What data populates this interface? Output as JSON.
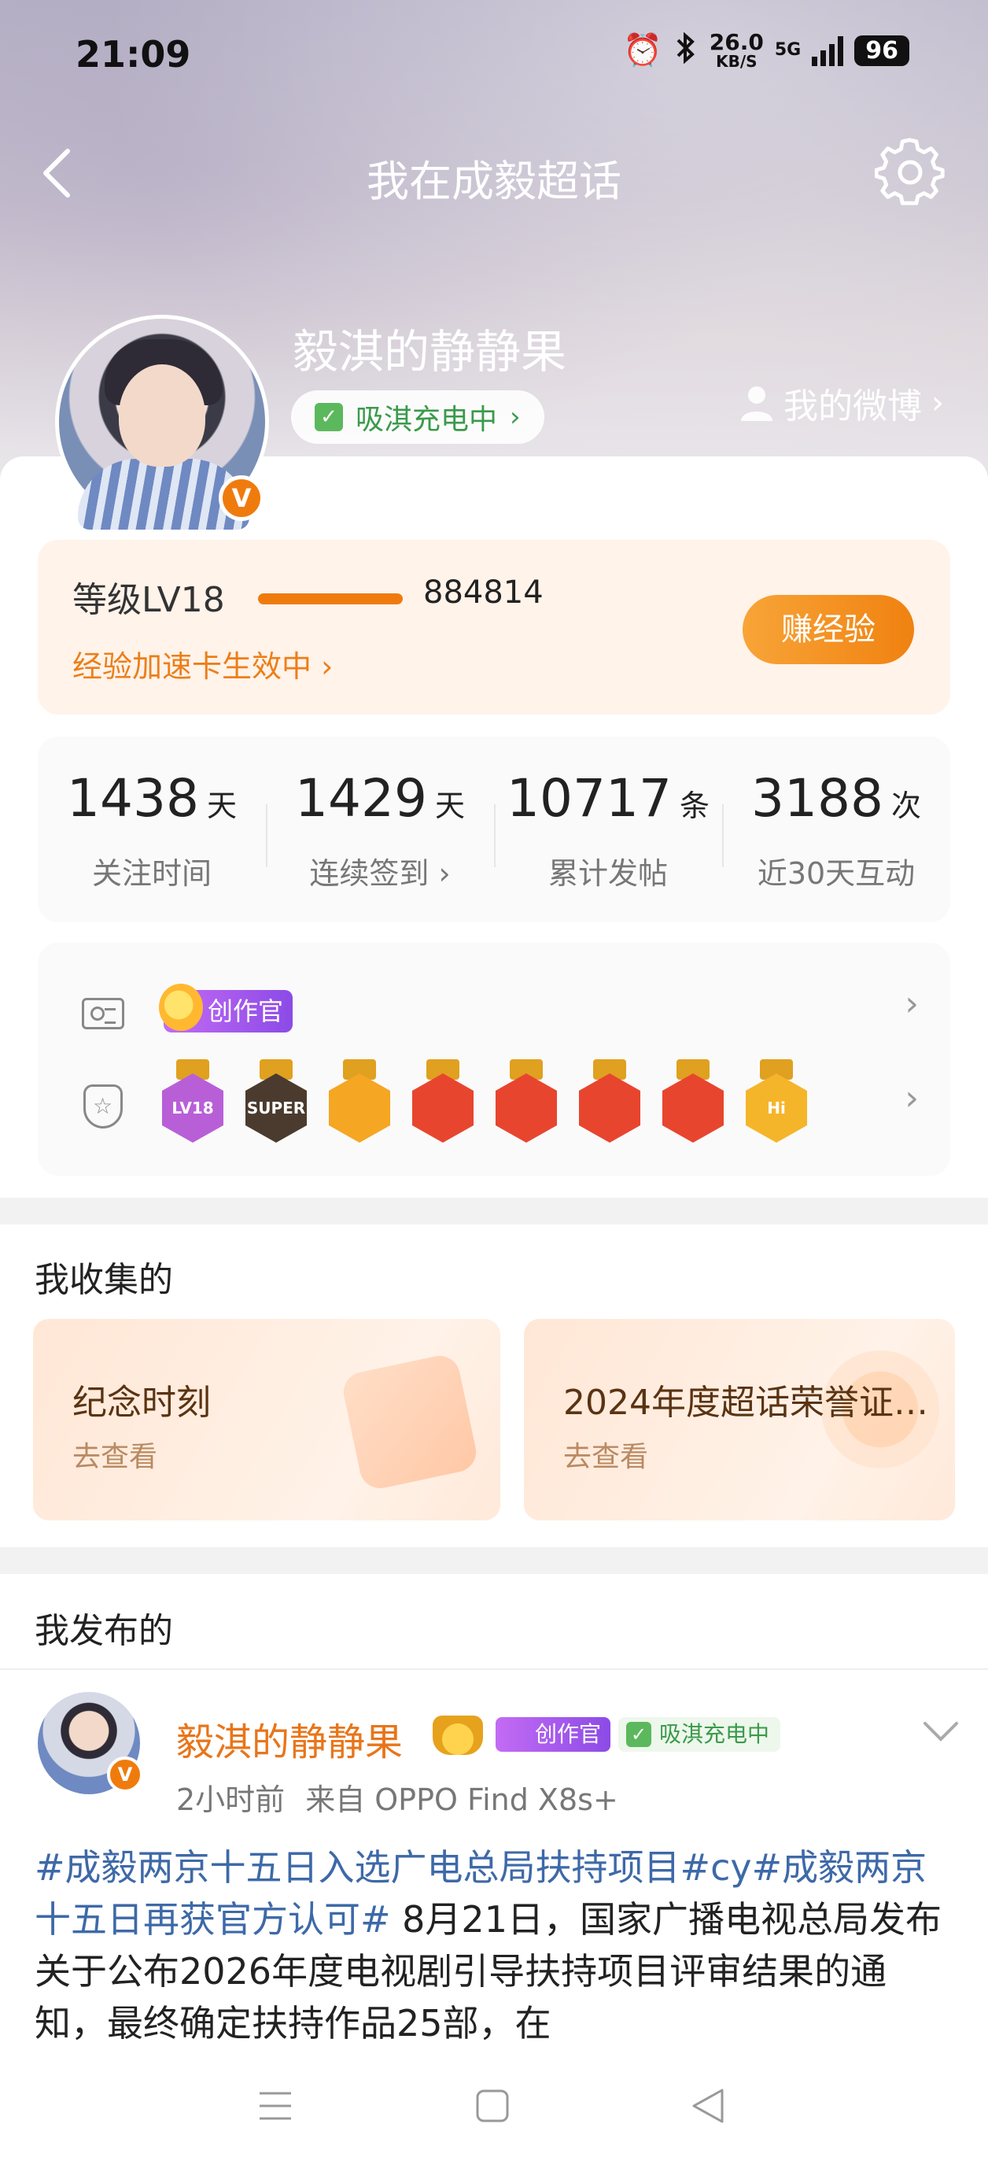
{
  "status_bar": {
    "time": "21:09",
    "net_speed": "26.0",
    "net_unit": "KB/S",
    "net_type": "5G",
    "battery": "96"
  },
  "nav": {
    "title": "我在成毅超话"
  },
  "profile": {
    "username": "毅淇的静静果",
    "charge_label": "吸淇充电中",
    "my_weibo": "我的微博",
    "verified_mark": "V"
  },
  "level": {
    "label": "等级LV18",
    "progress": 1.0,
    "points": "884814",
    "boost": "经验加速卡生效中",
    "earn_button": "赚经验"
  },
  "stats": [
    {
      "value": "1438",
      "unit": "天",
      "label": "关注时间"
    },
    {
      "value": "1429",
      "unit": "天",
      "label": "连续签到 ›"
    },
    {
      "value": "10717",
      "unit": "条",
      "label": "累计发帖"
    },
    {
      "value": "3188",
      "unit": "次",
      "label": "近30天互动"
    }
  ],
  "badges": {
    "creator_tag": "创作官",
    "medals": [
      {
        "text": "LV18",
        "color": "#b85fd8"
      },
      {
        "text": "SUPER",
        "color": "#4a3b2e"
      },
      {
        "text": "",
        "color": "#f5a623"
      },
      {
        "text": "",
        "color": "#e8452f"
      },
      {
        "text": "",
        "color": "#e8452f"
      },
      {
        "text": "",
        "color": "#e8452f"
      },
      {
        "text": "",
        "color": "#e8452f"
      },
      {
        "text": "Hi",
        "color": "#f5b52a"
      }
    ]
  },
  "collected": {
    "title": "我收集的",
    "cards": [
      {
        "title": "纪念时刻",
        "sub": "去查看"
      },
      {
        "title": "2024年度超话荣誉证…",
        "sub": "去查看"
      }
    ]
  },
  "posted": {
    "title": "我发布的",
    "post": {
      "author": "毅淇的静静果",
      "creator_tag": "创作官",
      "charge_tag": "吸淇充电中",
      "time": "2小时前",
      "source": "来自 OPPO Find X8s+",
      "tag1": "#成毅两京十五日入选广电总局扶持项目#",
      "tag2": "cy",
      "tag3": "#成毅两京十五日再获官方认可#",
      "text": " 8月21日，国家广播电视总局发布关于公布2026年度电视剧引导扶持项目评审结果的通知，最终确定扶持作品25部，在"
    }
  }
}
